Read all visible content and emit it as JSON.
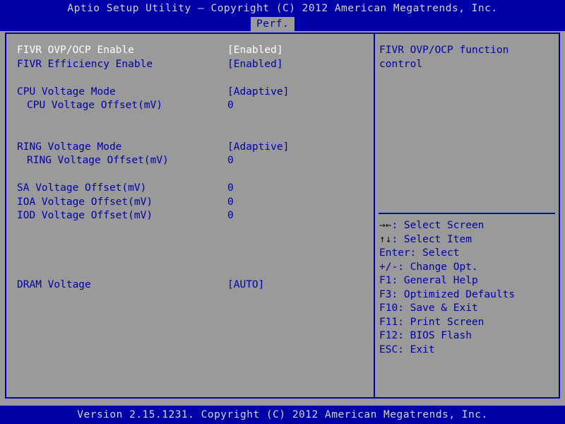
{
  "titlebar": {
    "text": "Aptio Setup Utility – Copyright (C) 2012 American Megatrends, Inc."
  },
  "tabs": {
    "active_label": "Perf."
  },
  "settings": {
    "rows": [
      {
        "label": "FIVR OVP/OCP Enable",
        "value": "[Enabled]",
        "indent": false,
        "selected": true,
        "blank": false
      },
      {
        "label": "FIVR Efficiency Enable",
        "value": "[Enabled]",
        "indent": false,
        "selected": false,
        "blank": false
      },
      {
        "label": "",
        "value": "",
        "indent": false,
        "selected": false,
        "blank": true
      },
      {
        "label": "CPU Voltage Mode",
        "value": "[Adaptive]",
        "indent": false,
        "selected": false,
        "blank": false
      },
      {
        "label": "CPU Voltage Offset(mV)",
        "value": "0",
        "indent": true,
        "selected": false,
        "blank": false
      },
      {
        "label": "",
        "value": "",
        "indent": false,
        "selected": false,
        "blank": true
      },
      {
        "label": "",
        "value": "",
        "indent": false,
        "selected": false,
        "blank": true
      },
      {
        "label": "RING Voltage Mode",
        "value": "[Adaptive]",
        "indent": false,
        "selected": false,
        "blank": false
      },
      {
        "label": "RING Voltage Offset(mV)",
        "value": "0",
        "indent": true,
        "selected": false,
        "blank": false
      },
      {
        "label": "",
        "value": "",
        "indent": false,
        "selected": false,
        "blank": true
      },
      {
        "label": "SA Voltage Offset(mV)",
        "value": "0",
        "indent": false,
        "selected": false,
        "blank": false
      },
      {
        "label": "IOA Voltage Offset(mV)",
        "value": "0",
        "indent": false,
        "selected": false,
        "blank": false
      },
      {
        "label": "IOD Voltage Offset(mV)",
        "value": "0",
        "indent": false,
        "selected": false,
        "blank": false
      },
      {
        "label": "",
        "value": "",
        "indent": false,
        "selected": false,
        "blank": true
      },
      {
        "label": "",
        "value": "",
        "indent": false,
        "selected": false,
        "blank": true
      },
      {
        "label": "",
        "value": "",
        "indent": false,
        "selected": false,
        "blank": true
      },
      {
        "label": "",
        "value": "",
        "indent": false,
        "selected": false,
        "blank": true
      },
      {
        "label": "DRAM Voltage",
        "value": "[AUTO]",
        "indent": false,
        "selected": false,
        "blank": false
      }
    ]
  },
  "help": {
    "description": "FIVR OVP/OCP function control",
    "keys": [
      {
        "glyph": "→←",
        "text": ": Select Screen"
      },
      {
        "glyph": "↑↓",
        "text": ": Select Item"
      },
      {
        "glyph": "",
        "text": "Enter: Select"
      },
      {
        "glyph": "",
        "text": "+/-: Change Opt."
      },
      {
        "glyph": "",
        "text": "F1: General Help"
      },
      {
        "glyph": "",
        "text": "F3: Optimized Defaults"
      },
      {
        "glyph": "",
        "text": "F10: Save & Exit"
      },
      {
        "glyph": "",
        "text": "F11: Print Screen"
      },
      {
        "glyph": "",
        "text": "F12: BIOS Flash"
      },
      {
        "glyph": "",
        "text": "ESC: Exit"
      }
    ]
  },
  "footer": {
    "text": "Version 2.15.1231. Copyright (C) 2012 American Megatrends, Inc."
  },
  "colors": {
    "header_bg": "#0000a8",
    "panel_bg": "#9a9a9a",
    "text_blue": "#0000a8",
    "text_selected": "#ffffff",
    "border": "#0000b0"
  }
}
